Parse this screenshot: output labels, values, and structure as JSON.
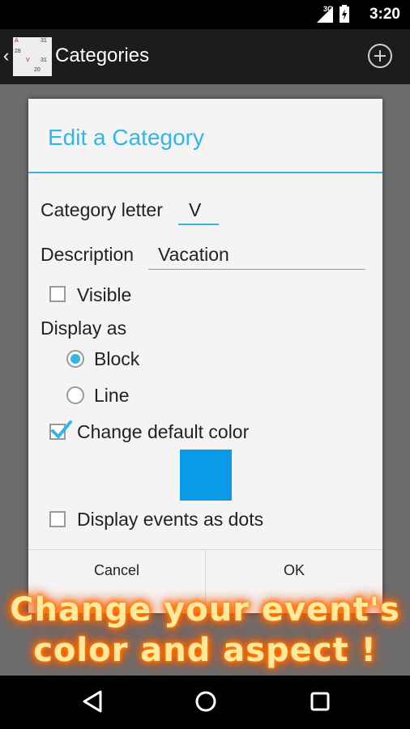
{
  "status_bar": {
    "network": "3G",
    "time": "3:20"
  },
  "action_bar": {
    "back": "‹",
    "title": "Categories",
    "logo_cells": [
      "A",
      "31",
      "28",
      "31",
      "V",
      "20"
    ]
  },
  "dialog": {
    "title": "Edit a Category",
    "category_letter_label": "Category letter",
    "category_letter_value": "V",
    "description_label": "Description",
    "description_value": "Vacation",
    "visible_label": "Visible",
    "visible_checked": false,
    "display_as_label": "Display as",
    "display_options": [
      {
        "label": "Block",
        "selected": true
      },
      {
        "label": "Line",
        "selected": false
      }
    ],
    "change_color_label": "Change default color",
    "change_color_checked": true,
    "selected_color": "#0a9ae6",
    "dots_label": "Display events as dots",
    "dots_checked": false,
    "cancel_label": "Cancel",
    "ok_label": "OK"
  },
  "promo": {
    "line1": "Change your event's",
    "line2": "color and aspect !"
  },
  "accent_color": "#33b5e5"
}
